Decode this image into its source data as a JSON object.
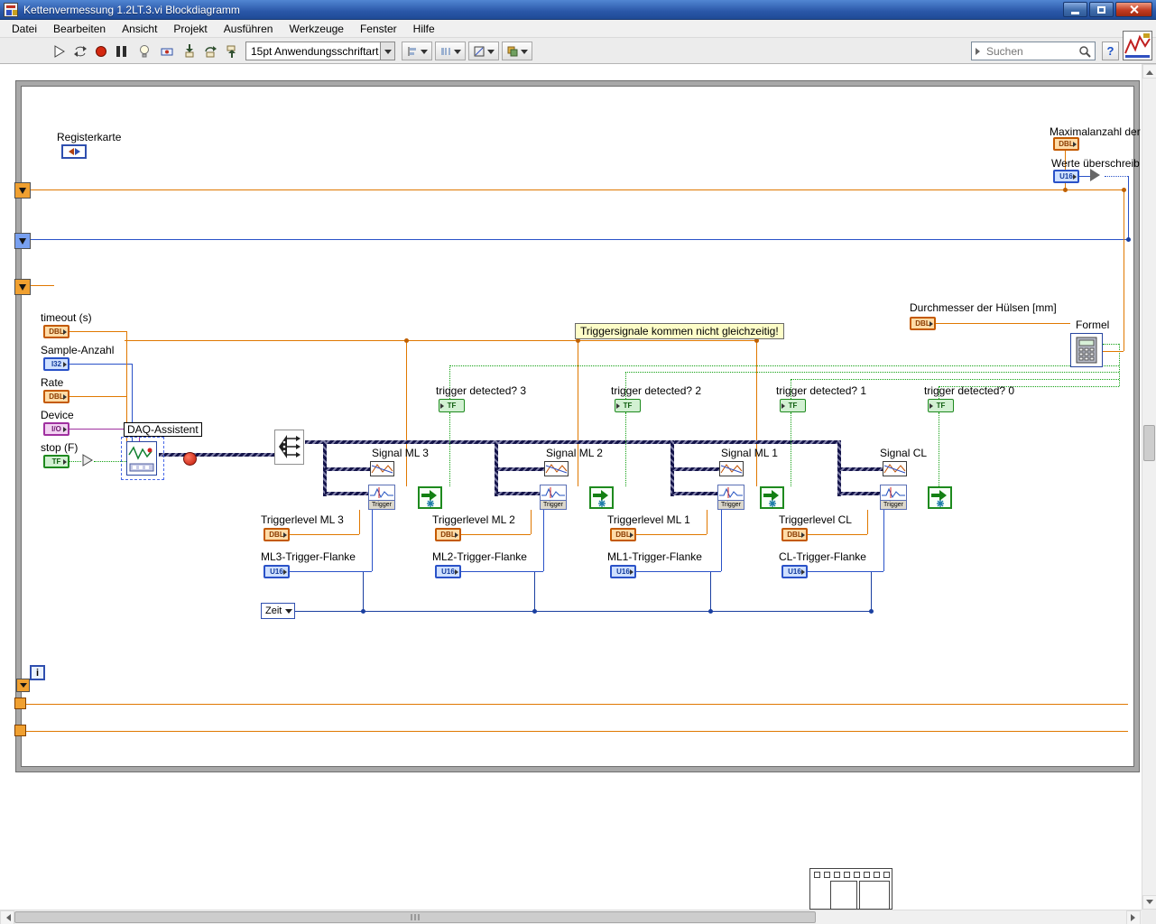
{
  "window": {
    "title": "Kettenvermessung 1.2LT.3.vi Blockdiagramm"
  },
  "menu": {
    "items": [
      "Datei",
      "Bearbeiten",
      "Ansicht",
      "Projekt",
      "Ausführen",
      "Werkzeuge",
      "Fenster",
      "Hilfe"
    ]
  },
  "toolbar": {
    "font_selector": "15pt Anwendungsschriftart",
    "search_placeholder": "Suchen",
    "help_label": "?"
  },
  "types": {
    "dbl": "DBL",
    "i32": "I32",
    "u16": "U16",
    "tf": "TF",
    "io": "I/O"
  },
  "diagram": {
    "registerkarte_label": "Registerkarte",
    "max_anzahl_label": "Maximalanzahl der",
    "werte_label": "Werte überschreib",
    "timeout_label": "timeout (s)",
    "sample_label": "Sample-Anzahl",
    "rate_label": "Rate",
    "device_label": "Device",
    "stop_label": "stop (F)",
    "daq_label": "DAQ-Assistent",
    "comment": "Triggersignale kommen nicht gleichzeitig!",
    "durchmesser_label": "Durchmesser der Hülsen [mm]",
    "formel_label": "Formel",
    "zeit_label": "Zeit",
    "trigger_vi_label": "Trigger",
    "iteration_label": "i",
    "channels": [
      {
        "signal": "Signal ML 3",
        "detected": "trigger detected? 3",
        "level": "Triggerlevel ML 3",
        "flanke": "ML3-Trigger-Flanke"
      },
      {
        "signal": "Signal ML 2",
        "detected": "trigger detected? 2",
        "level": "Triggerlevel ML 2",
        "flanke": "ML2-Trigger-Flanke"
      },
      {
        "signal": "Signal ML 1",
        "detected": "trigger detected? 1",
        "level": "Triggerlevel ML 1",
        "flanke": "ML1-Trigger-Flanke"
      },
      {
        "signal": "Signal CL",
        "detected": "trigger detected? 0",
        "level": "Triggerlevel CL",
        "flanke": "CL-Trigger-Flanke"
      }
    ]
  },
  "colors": {
    "wire_dbl": "#e07800",
    "wire_int": "#2a52c8",
    "wire_bool": "#12a012",
    "wire_io": "#a030a0",
    "dynamic_data": "#14144a",
    "loop_border": "#a8a8a8",
    "titlebar": "#2a57a8",
    "close_button": "#c23c22",
    "comment_bg": "#fdfdc8"
  }
}
